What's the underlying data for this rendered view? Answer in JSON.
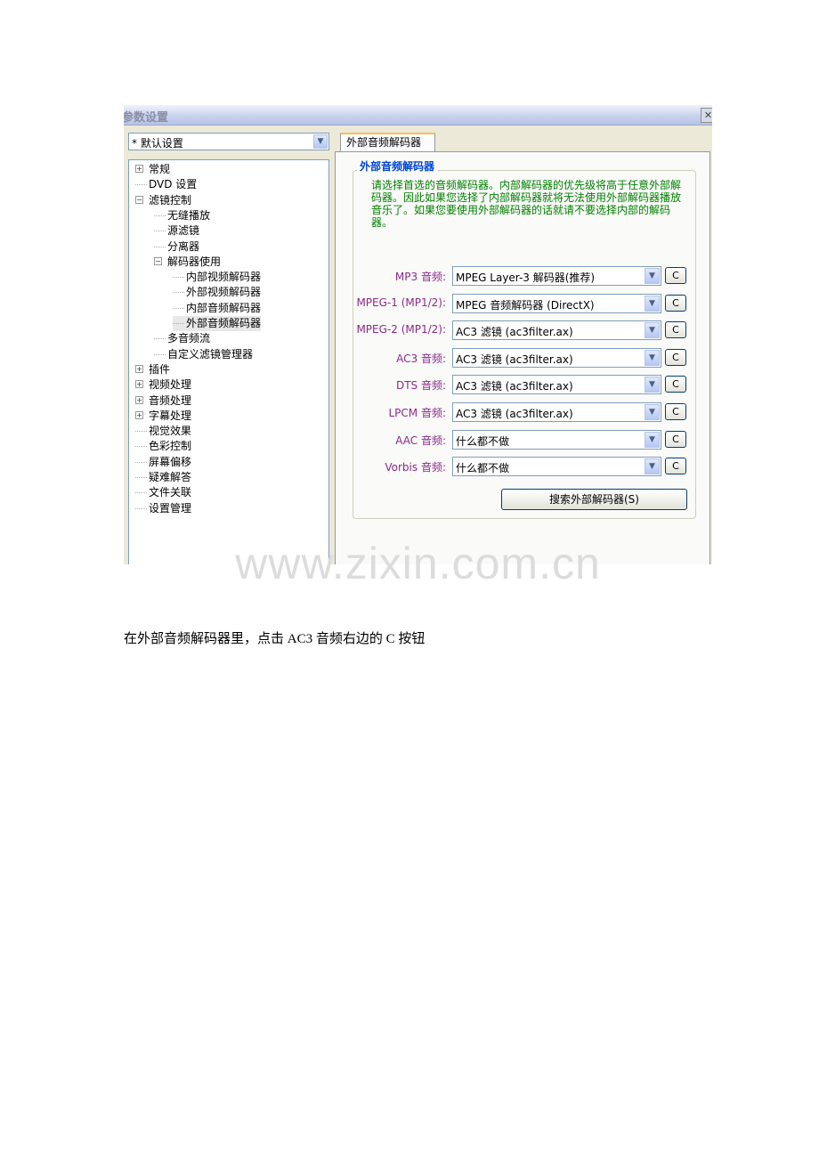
{
  "window": {
    "title": "参数设置",
    "close_symbol": "✕"
  },
  "profile": {
    "value": "* 默认设置",
    "arrow": "▼"
  },
  "tree": {
    "items": [
      {
        "label": "常规",
        "expander": "+"
      },
      {
        "label": "DVD 设置"
      },
      {
        "label": "滤镜控制",
        "expander": "−"
      },
      {
        "label": "无缝播放"
      },
      {
        "label": "源滤镜"
      },
      {
        "label": "分离器"
      },
      {
        "label": "解码器使用",
        "expander": "−"
      },
      {
        "label": "内部视频解码器"
      },
      {
        "label": "外部视频解码器"
      },
      {
        "label": "内部音频解码器"
      },
      {
        "label": "外部音频解码器",
        "selected": true
      },
      {
        "label": "多音频流"
      },
      {
        "label": "自定义滤镜管理器"
      },
      {
        "label": "插件",
        "expander": "+"
      },
      {
        "label": "视频处理",
        "expander": "+"
      },
      {
        "label": "音频处理",
        "expander": "+"
      },
      {
        "label": "字幕处理",
        "expander": "+"
      },
      {
        "label": "视觉效果"
      },
      {
        "label": "色彩控制"
      },
      {
        "label": "屏幕偏移"
      },
      {
        "label": "疑难解答"
      },
      {
        "label": "文件关联"
      },
      {
        "label": "设置管理"
      }
    ]
  },
  "tab": {
    "label": "外部音频解码器"
  },
  "group": {
    "title": "外部音频解码器",
    "description": "请选择首选的音频解码器。内部解码器的优先级将高于任意外部解码器。因此如果您选择了内部解码器就将无法使用外部解码器播放音乐了。如果您要使用外部解码器的话就请不要选择内部的解码器。"
  },
  "codecs": [
    {
      "label": "MP3 音频:",
      "value": "MPEG Layer-3 解码器(推荐)",
      "button": "C"
    },
    {
      "label": "MPEG-1 (MP1/2):",
      "value": "MPEG 音频解码器 (DirectX)",
      "button": "C"
    },
    {
      "label": "MPEG-2 (MP1/2):",
      "value": "AC3 滤镜 (ac3filter.ax)",
      "button": "C"
    },
    {
      "label": "AC3 音频:",
      "value": "AC3 滤镜 (ac3filter.ax)",
      "button": "C"
    },
    {
      "label": "DTS 音频:",
      "value": "AC3 滤镜 (ac3filter.ax)",
      "button": "C"
    },
    {
      "label": "LPCM 音频:",
      "value": "AC3 滤镜 (ac3filter.ax)",
      "button": "C"
    },
    {
      "label": "AAC 音频:",
      "value": "什么都不做",
      "button": "C"
    },
    {
      "label": "Vorbis 音频:",
      "value": "什么都不做",
      "button": "C"
    }
  ],
  "dropdown_arrow": "▼",
  "search_button": "搜索外部解码器(S)",
  "watermark": "www.zixin.com.cn",
  "caption": "在外部音频解码器里，点击 AC3 音频右边的 C 按钮"
}
